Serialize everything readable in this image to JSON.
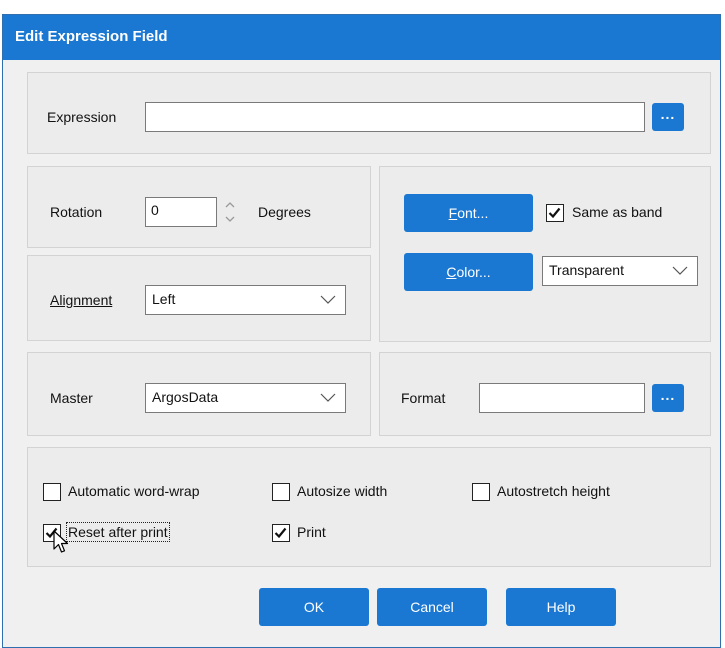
{
  "window": {
    "title": "Edit Expression Field"
  },
  "expression": {
    "label": "Expression",
    "value": "",
    "browse_label": "..."
  },
  "rotation": {
    "label": "Rotation",
    "value": "0",
    "unit_label": "Degrees"
  },
  "font_button": {
    "label": "Font..."
  },
  "same_as_band": {
    "label": "Same as band",
    "checked": true
  },
  "color_button": {
    "label": "Color..."
  },
  "color_select": {
    "value": "Transparent"
  },
  "alignment": {
    "label": "Alignment",
    "value": "Left"
  },
  "master": {
    "label": "Master",
    "value": "ArgosData"
  },
  "format": {
    "label": "Format",
    "value": "",
    "browse_label": "..."
  },
  "options": {
    "automatic_word_wrap": {
      "label": "Automatic word-wrap",
      "checked": false
    },
    "autosize_width": {
      "label": "Autosize width",
      "checked": false
    },
    "autostretch_height": {
      "label": "Autostretch height",
      "checked": false
    },
    "reset_after_print": {
      "label": "Reset after print",
      "checked": true
    },
    "print": {
      "label": "Print",
      "checked": true
    }
  },
  "buttons": {
    "ok": "OK",
    "cancel": "Cancel",
    "help": "Help"
  },
  "colors": {
    "accent": "#1a78d2",
    "dialog_bg": "#f0f0f0",
    "group_bg": "#ececec"
  },
  "icons": [
    "spin-up-icon",
    "spin-down-icon",
    "chevron-down-icon",
    "checkmark-icon",
    "mouse-cursor-icon"
  ]
}
